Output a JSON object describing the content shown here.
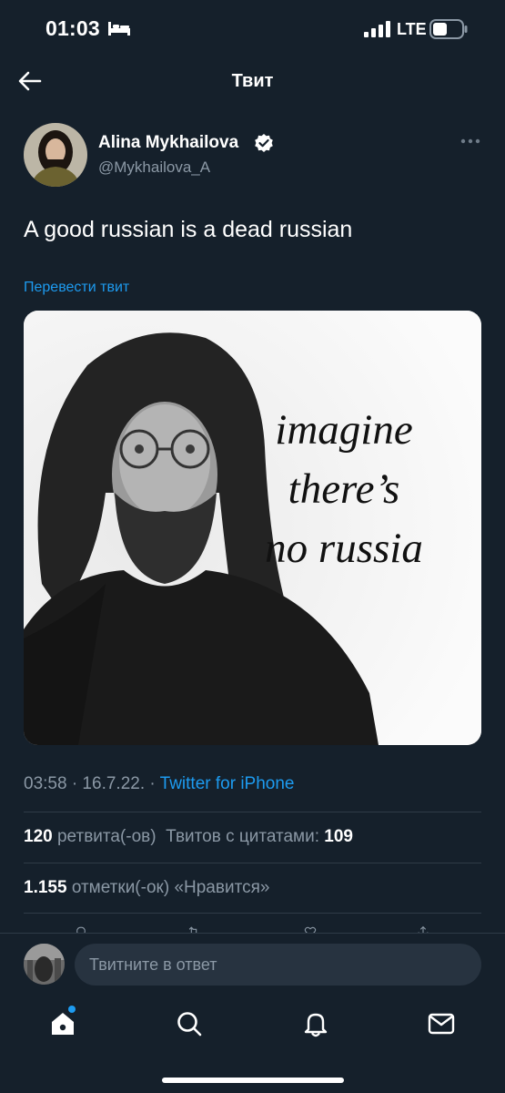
{
  "status_bar": {
    "time": "01:03",
    "network": "LTE"
  },
  "header": {
    "title": "Твит"
  },
  "author": {
    "name": "Alina Mykhailova",
    "handle": "@Mykhailova_A",
    "verified": true
  },
  "tweet": {
    "text": "A good russian is a dead russian",
    "translate_label": "Перевести твит",
    "media_caption": [
      "imagine",
      "there’s",
      "no russia"
    ],
    "timestamp": "03:58 · 16.7.22. · ",
    "source": "Twitter for iPhone"
  },
  "stats": {
    "retweets_count": "120",
    "retweets_label": "ретвита(-ов)",
    "quotes_label": "Твитов с цитатами:",
    "quotes_count": "109",
    "likes_count": "1.155",
    "likes_label": "отметки(-ок) «Нравится»"
  },
  "reply": {
    "placeholder": "Твитните в ответ"
  },
  "tab_bar": {
    "items": [
      "home-icon",
      "search-icon",
      "notifications-icon",
      "messages-icon"
    ],
    "home_badge": true
  },
  "colors": {
    "background": "#15202b",
    "accent": "#1d9bf0",
    "secondary_text": "#8b98a5"
  }
}
